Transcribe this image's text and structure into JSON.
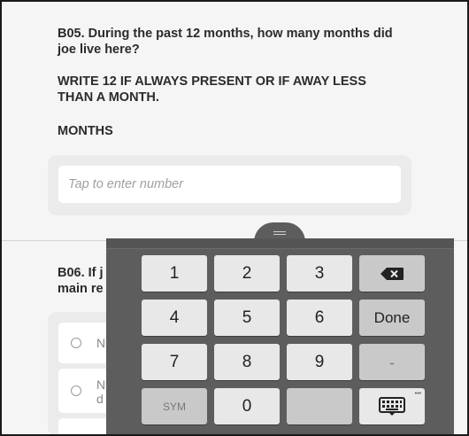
{
  "questions": {
    "b05": {
      "title": "B05. During the past 12 months, how many months did joe live here?",
      "instruction": "WRITE 12 IF ALWAYS PRESENT OR IF AWAY LESS THAN A MONTH.",
      "unit": "MONTHS",
      "input_placeholder": "Tap to enter number",
      "input_value": ""
    },
    "b06": {
      "title_visible": "B06. If j",
      "title_line2_visible": "main re",
      "options": [
        {
          "label_visible": "N"
        },
        {
          "label_line1_visible": "N",
          "label_line2_visible": "d"
        }
      ]
    }
  },
  "keyboard": {
    "keys": {
      "k1": "1",
      "k2": "2",
      "k3": "3",
      "k4": "4",
      "k5": "5",
      "k6": "6",
      "k7": "7",
      "k8": "8",
      "k9": "9",
      "k0": "0",
      "done": "Done",
      "dash": "-",
      "sym": "SYM",
      "backspace_icon": "backspace-icon",
      "keyboard_icon": "keyboard-settings-icon"
    }
  },
  "colors": {
    "keyboard_bg": "#5d5d5d",
    "key_bg": "#e8e8e8",
    "func_key_bg": "#c9c9c9",
    "page_bg": "#f5f5f5"
  }
}
